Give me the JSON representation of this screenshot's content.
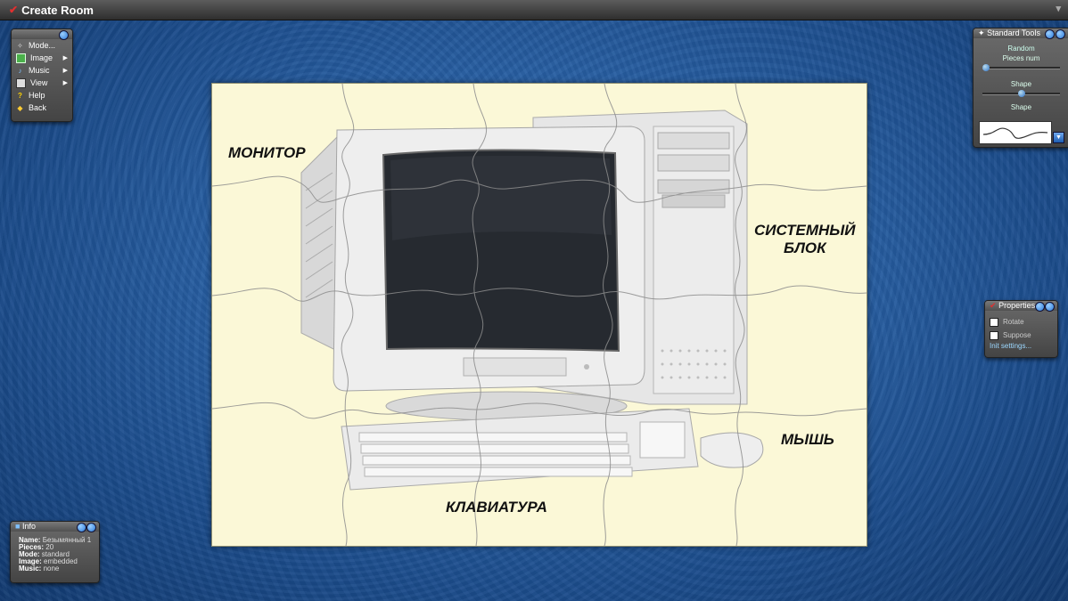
{
  "window": {
    "title": "Create Room"
  },
  "menu": {
    "items": [
      {
        "label": "Mode...",
        "icon": "wand-icon"
      },
      {
        "label": "Image",
        "icon": "image-icon",
        "submenu": true
      },
      {
        "label": "Music",
        "icon": "music-icon",
        "submenu": true
      },
      {
        "label": "View",
        "icon": "view-icon",
        "submenu": true
      },
      {
        "label": "Help",
        "icon": "help-icon"
      },
      {
        "label": "Back",
        "icon": "back-icon"
      }
    ]
  },
  "puzzle": {
    "labels": {
      "monitor": "МОНИТОР",
      "system_unit_line1": "СИСТЕМНЫЙ",
      "system_unit_line2": "БЛОК",
      "mouse": "МЫШЬ",
      "keyboard": "КЛАВИАТУРА"
    }
  },
  "tools": {
    "title": "Standard Tools",
    "mode": "Random",
    "pieces_label": "Pieces num",
    "pieces_slider": 0.0,
    "shape_label": "Shape",
    "shape_slider": 0.5,
    "shape_picker_label": "Shape"
  },
  "properties": {
    "title": "Properties",
    "rotate": "Rotate",
    "suppose": "Suppose",
    "link": "Init settings..."
  },
  "info": {
    "title": "Info",
    "rows": [
      {
        "k": "Name:",
        "v": "Безымянный 1"
      },
      {
        "k": "Pieces:",
        "v": "20"
      },
      {
        "k": "Mode:",
        "v": "standard"
      },
      {
        "k": "Image:",
        "v": "embedded"
      },
      {
        "k": "Music:",
        "v": "none"
      }
    ]
  },
  "colors": {
    "accent": "#2a78d8",
    "background": "#2a63a8",
    "puzzle_bg": "#fbf8d7"
  }
}
